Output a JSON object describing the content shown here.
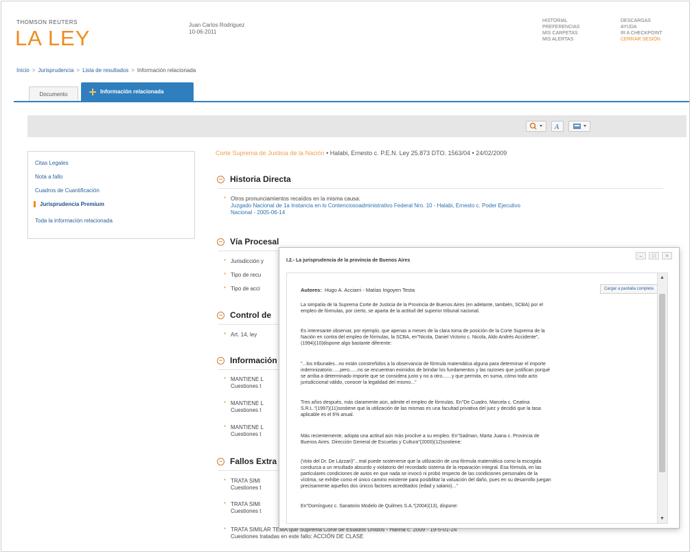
{
  "header": {
    "brand_small": "THOMSON REUTERS",
    "brand_big": "LA LEY",
    "user_name": "Juan Carlos Rodriguez",
    "user_date": "10-06-2011",
    "menu_col1": [
      "HISTORIAL",
      "PREFERENCIAS",
      "MIS CARPETAS",
      "MIS ALERTAS"
    ],
    "menu_col2": [
      "DESCARGAS",
      "AYUDA",
      "IR A CHECKPOINT"
    ],
    "close_session": "CERRAR SESIÓN"
  },
  "breadcrumb": [
    "Inicio",
    "Jurisprudencia",
    "Lista de resultados",
    "Información relacionada"
  ],
  "tabs": [
    "Documento",
    "Información relacionada"
  ],
  "sidebar": {
    "items": [
      "Citas Legales",
      "Nota a fallo",
      "Cuadros de Cuantificación",
      "Jurisprudencia Premium",
      "Toda la información relacionada"
    ]
  },
  "main": {
    "court": "Corte Suprema de Justicia de la Nación",
    "case": " • Halabi, Ernesto c. P.E.N. Ley 25.873 DTO. 1563/04 • 24/02/2009",
    "historia": {
      "title": "Historia Directa",
      "line1": "Otros pronunciamientos recaídos en la misma causa:",
      "link1": "Juzgado Nacional de 1a Instancia en lo Contenciosoadministrativo Federal Nro. 10 - Halabi, Ernesto c. Poder Ejecutivo",
      "link2": "Nacional - 2005-06-14"
    },
    "via": {
      "title": "Vía Procesal",
      "items": [
        "Jurisdicción y",
        "Tipo de recu",
        "Tipo de acci"
      ]
    },
    "control": {
      "title": "Control de",
      "items": [
        "Art. 14, ley"
      ]
    },
    "info": {
      "title": "Información",
      "items": [
        {
          "l1": "MANTIENE L",
          "l2": "Cuestiones t"
        },
        {
          "l1": "MANTIENE L",
          "l2": "Cuestiones t"
        },
        {
          "l1": "MANTIENE L",
          "l2": "Cuestiones t"
        }
      ]
    },
    "fallos": {
      "title": "Fallos Extra",
      "items": [
        {
          "l1": "TRATA SIMI",
          "l2": "Cuestiones t"
        },
        {
          "l1": "TRATA SIMI",
          "l2": "Cuestiones t"
        },
        {
          "l1": "TRATA SIMILAR TEMA que Suprema Corte de Estados Unidos - Hanna c. 2009 - 19-5-01-24",
          "l2": "Cuestiones tratadas en este fallo: ACCIÓN DE CLASE"
        }
      ]
    }
  },
  "modal": {
    "title": "I.2.- La jurisprudencia de la provincia de Buenos Aires",
    "authors_label": "Autores:",
    "authors": "Hugo A. Acciarri - Matías Irigoyen Testa",
    "load_button": "Cargar a pantalla completa",
    "paragraphs": [
      "La simpatía de la Suprema Corte de Justicia de la Provincia de Buenos Aires (en adelante, también, SCBA) por el",
      "empleo de fórmulas, por cierto, se aparta de la actitud del superior tribunal nacional.",
      "Es interesante observar, por ejemplo, que apenas a meses de la clara toma de posición de la Corte Suprema de la",
      "Nación en contra del empleo de fórmulas, la SCBA, en\"Nicola, Daniel Victorio c. Nicola, Aldo Andrés Accidente\",",
      "(1994)(10)dispone algo bastante diferente:",
      "\"...los tribunales...no están constreñidos a la observancia de fórmula matemática alguna para determinar el importe",
      "indemnizatorio......pero......no se encuentran eximidos de brindar los fundamentos y las razones que justifican porqué",
      "se arriba a determinado importe que se considera justo y no a otro.......y que permita, en suma, cómo todo acto",
      "jurisdiccional válido, conocer la legalidad del mismo...\"",
      "Tres años después, más claramente aún, admite el empleo de fórmulas. En\"De Cuadro, Marcela c. Ceatina",
      "S.R.L.\"(1997)(11)sostiene que la utilización de las mismas es una facultad privativa del juez y decidió que la tasa",
      "aplicable es el 6% anual.",
      "Más recientemente, adopta una actitud aún más proclive a su empleo. En\"Sadman, Marta Juana c. Provincia de",
      "Buenos Aires. Dirección General de Escuelas y Cultura\"(2000)(12)sostiene:",
      "(Voto del Dr. De Lázzari)\"...mal puede sostenerse que la utilización de una fórmula matemática como la escogida",
      "conduzca a un resultado absurdo y violatorio del recordado sistema de la reparación integral. Esa fórmula, en las",
      "particulares condiciones de autos en que nada se invocó ni probó respecto de las condiciones personales de la",
      "víctima, se exhibe como el único camino existente para posibilitar la valuación del daño, pues en su desarrollo juegan",
      "precisamente aquellos dos únicos factores acreditados (edad y salario)...\"",
      "En\"Domínguez c. Sanatorio Modelo de Quilmes S.A.\"(2004)(13), dispone:"
    ]
  }
}
